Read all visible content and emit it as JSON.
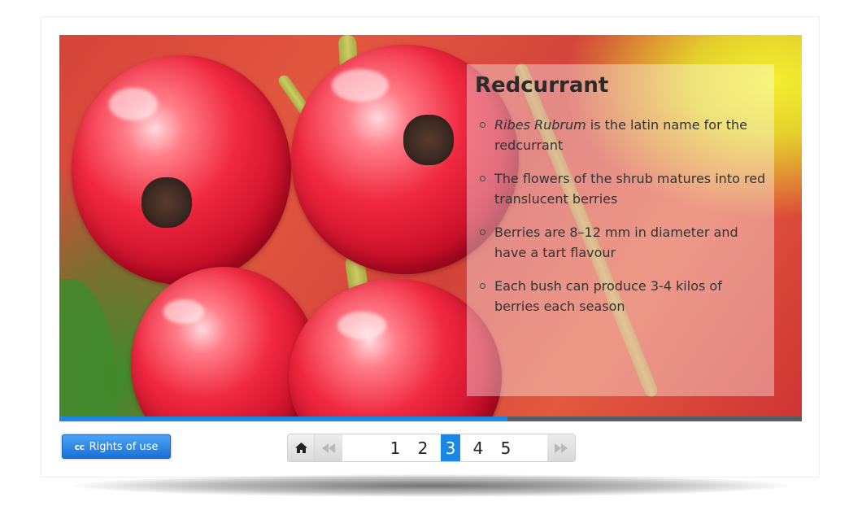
{
  "slide": {
    "title": "Redcurrant",
    "bullets": [
      {
        "em": "Ribes Rubrum",
        "text": " is the latin name for the redcurrant"
      },
      {
        "em": "",
        "text": "The flowers of the shrub matures into red translucent berries"
      },
      {
        "em": "",
        "text": "Berries are 8–12 mm in diameter and have a tart flavour"
      },
      {
        "em": "",
        "text": "Each bush can produce 3-4 kilos of berries each season"
      }
    ]
  },
  "progress": {
    "fraction": 0.603
  },
  "rights": {
    "icon": "cc-icon",
    "icon_text": "cc",
    "label": "Rights of use"
  },
  "pager": {
    "home_icon": "home-icon",
    "prev_icon": "rewind-icon",
    "next_icon": "fast-forward-icon",
    "pages": [
      "1",
      "2",
      "3",
      "4",
      "5"
    ],
    "current": "3"
  },
  "colors": {
    "accent": "#1b86e3",
    "progress_track": "#555e66"
  }
}
